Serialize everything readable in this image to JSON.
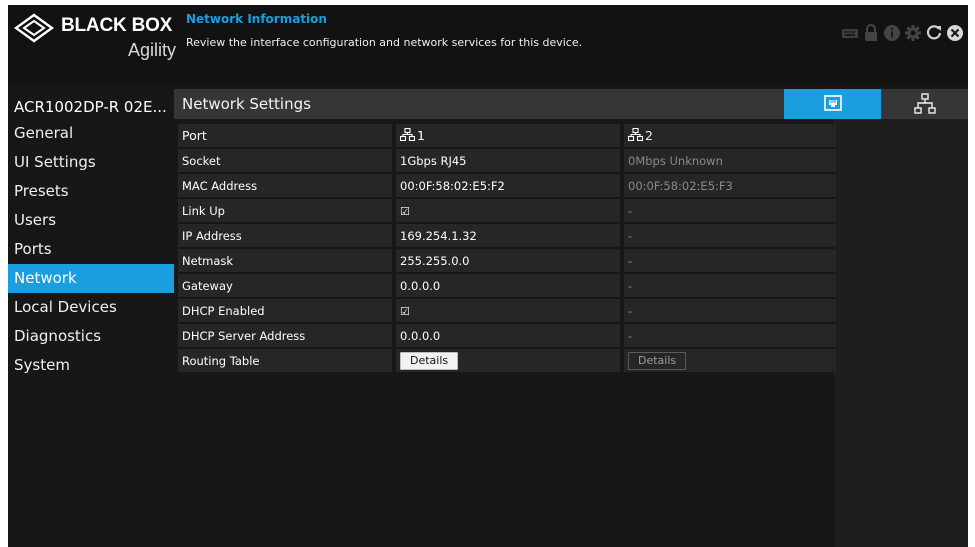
{
  "header": {
    "brand": "BLACK BOX",
    "sub_brand": "Agility",
    "title": "Network Information",
    "description": "Review the interface configuration and network services for this device.",
    "icons": [
      "keyboard-icon",
      "lock-icon",
      "info-icon",
      "settings-icon",
      "refresh-icon",
      "close-icon"
    ]
  },
  "device": {
    "name": "ACR1002DP-R 02E..."
  },
  "sidebar": {
    "items": [
      {
        "label": "General",
        "active": false
      },
      {
        "label": "UI Settings",
        "active": false
      },
      {
        "label": "Presets",
        "active": false
      },
      {
        "label": "Users",
        "active": false
      },
      {
        "label": "Ports",
        "active": false
      },
      {
        "label": "Network",
        "active": true
      },
      {
        "label": "Local Devices",
        "active": false
      },
      {
        "label": "Diagnostics",
        "active": false
      },
      {
        "label": "System",
        "active": false
      }
    ]
  },
  "main": {
    "title": "Network Settings",
    "view_buttons": [
      {
        "name": "port-view-icon",
        "active": true
      },
      {
        "name": "network-view-icon",
        "active": false
      }
    ]
  },
  "table": {
    "headers": {
      "label": "Port",
      "port1": "1",
      "port2": "2"
    },
    "rows": [
      {
        "label": "Socket",
        "port1": "1Gbps RJ45",
        "port2": "0Mbps Unknown"
      },
      {
        "label": "MAC Address",
        "port1": "00:0F:58:02:E5:F2",
        "port2": "00:0F:58:02:E5:F3"
      },
      {
        "label": "Link Up",
        "port1": "☑",
        "port2": "-"
      },
      {
        "label": "IP Address",
        "port1": "169.254.1.32",
        "port2": "-"
      },
      {
        "label": "Netmask",
        "port1": "255.255.0.0",
        "port2": "-"
      },
      {
        "label": "Gateway",
        "port1": "0.0.0.0",
        "port2": "-"
      },
      {
        "label": "DHCP Enabled",
        "port1": "☑",
        "port2": "-"
      },
      {
        "label": "DHCP Server Address",
        "port1": "0.0.0.0",
        "port2": "-"
      },
      {
        "label": "Routing Table",
        "port1": "Details",
        "port2": "Details"
      }
    ]
  },
  "colors": {
    "accent": "#1a9ee0",
    "background": "#171717",
    "row_bg": "#262626",
    "bar_bg": "#363636"
  }
}
